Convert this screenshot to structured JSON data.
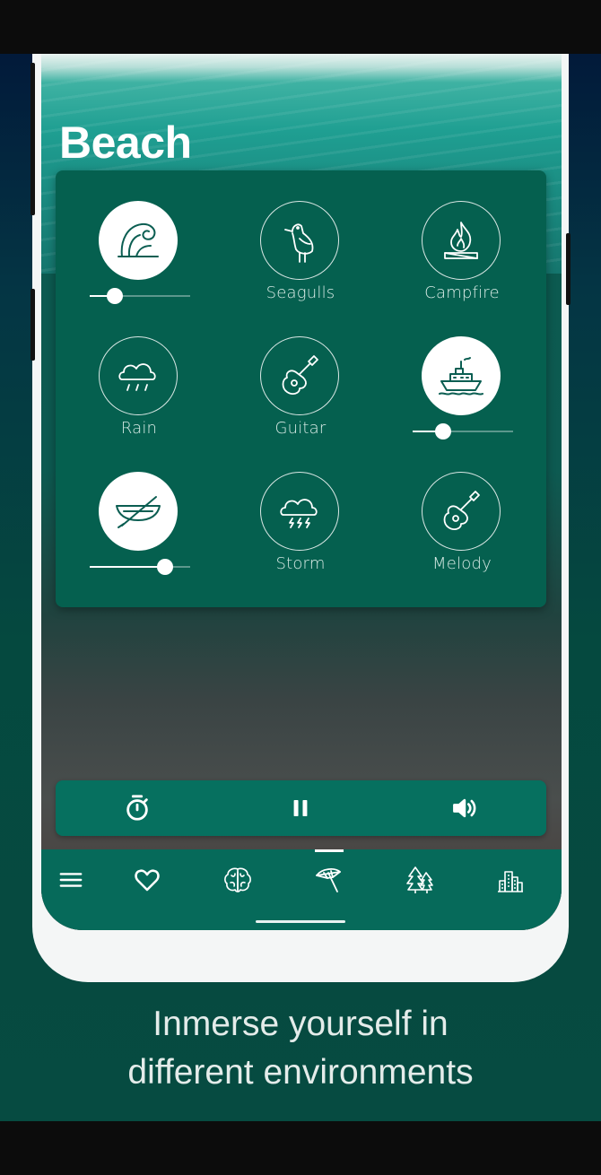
{
  "screen": {
    "title": "Beach"
  },
  "sounds": [
    {
      "label": "",
      "icon": "wave-icon",
      "active": true,
      "volume": 0.25
    },
    {
      "label": "Seagulls",
      "icon": "seagull-icon",
      "active": false
    },
    {
      "label": "Campfire",
      "icon": "campfire-icon",
      "active": false
    },
    {
      "label": "Rain",
      "icon": "rain-cloud-icon",
      "active": false
    },
    {
      "label": "Guitar",
      "icon": "guitar-icon",
      "active": false
    },
    {
      "label": "",
      "icon": "ship-icon",
      "active": true,
      "volume": 0.3
    },
    {
      "label": "",
      "icon": "rowboat-icon",
      "active": true,
      "volume": 0.75
    },
    {
      "label": "Storm",
      "icon": "storm-cloud-icon",
      "active": false
    },
    {
      "label": "Melody",
      "icon": "guitar-icon",
      "active": false
    }
  ],
  "controls": {
    "timer_icon": "timer-icon",
    "pause_icon": "pause-icon",
    "volume_icon": "volume-icon"
  },
  "nav": {
    "selected": "beach",
    "items": [
      {
        "key": "menu",
        "icon": "menu-icon"
      },
      {
        "key": "favorites",
        "icon": "heart-icon"
      },
      {
        "key": "focus",
        "icon": "brain-icon"
      },
      {
        "key": "beach",
        "icon": "beach-umbrella-icon"
      },
      {
        "key": "forest",
        "icon": "trees-icon"
      },
      {
        "key": "city",
        "icon": "city-icon"
      }
    ]
  },
  "promo": {
    "line1": "Inmerse yourself in",
    "line2": "different environments"
  },
  "colors": {
    "panel": "#05604f",
    "nav": "#066a5a",
    "accent": "#ffffff",
    "icon_active": "#0b5e52"
  }
}
